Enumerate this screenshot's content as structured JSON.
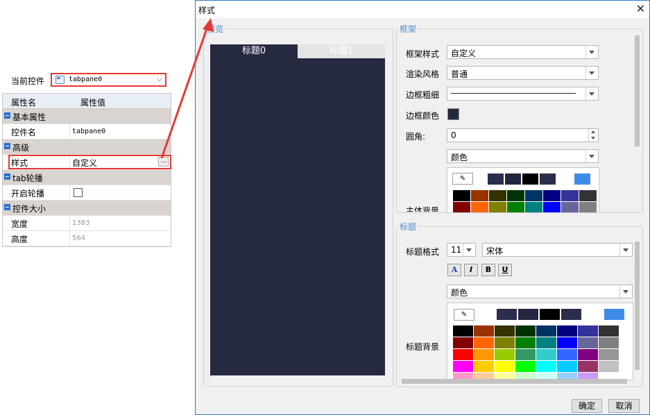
{
  "property_panel": {
    "current_control_label": "当前控件",
    "current_control_value": "tabpane0",
    "col_name": "属性名",
    "col_value": "属性值",
    "rows": [
      {
        "type": "category",
        "name": "基本属性"
      },
      {
        "type": "prop",
        "name": "控件名",
        "value": "tabpane0"
      },
      {
        "type": "category",
        "name": "高级"
      },
      {
        "type": "prop",
        "name": "样式",
        "value": "自定义",
        "ellipsis": "..."
      },
      {
        "type": "category",
        "name": "tab轮播"
      },
      {
        "type": "prop",
        "name": "开启轮播",
        "value": ""
      },
      {
        "type": "category",
        "name": "控件大小"
      },
      {
        "type": "prop",
        "name": "宽度",
        "value": "1383"
      },
      {
        "type": "prop",
        "name": "高度",
        "value": "564"
      }
    ]
  },
  "dialog": {
    "title": "样式",
    "close": "✕",
    "preview": {
      "legend": "预览",
      "tabs": [
        "标题0",
        "标题1"
      ]
    },
    "frame": {
      "legend": "框架",
      "frame_style_label": "框架样式",
      "frame_style_value": "自定义",
      "render_label": "渲染风格",
      "render_value": "普通",
      "border_width_label": "边框粗细",
      "border_color_label": "边框颜色",
      "radius_label": "圆角:",
      "radius_value": "0",
      "fill_value": "颜色",
      "body_bg_label": "主体背景"
    },
    "title_section": {
      "legend": "标题",
      "format_label": "标题格式",
      "size_value": "11",
      "font_value": "宋体",
      "bold_label": "B",
      "italic_label": "I",
      "underline_label": "U",
      "color_a_label": "A",
      "fill_value": "颜色",
      "bg_label": "标题背景"
    },
    "ok_label": "确定",
    "cancel_label": "取消"
  },
  "colors": {
    "accent": "#4a8bd0",
    "highlight": "#e53935",
    "preview_bg": "#262a40",
    "recent": [
      "#2b2e4a",
      "#242640",
      "#000000",
      "#2b2e4a",
      "#ffffff",
      "#3c8ce7"
    ],
    "palette_rows": [
      [
        "#000000",
        "#993300",
        "#333300",
        "#003300",
        "#003366",
        "#000080",
        "#333399",
        "#333333"
      ],
      [
        "#800000",
        "#ff6600",
        "#808000",
        "#008000",
        "#008080",
        "#0000ff",
        "#666699",
        "#808080"
      ],
      [
        "#ff0000",
        "#ff9900",
        "#99cc00",
        "#339966",
        "#33cccc",
        "#3366ff",
        "#800080",
        "#969696"
      ],
      [
        "#ff00ff",
        "#ffcc00",
        "#ffff00",
        "#00ff00",
        "#00ffff",
        "#00ccff",
        "#993366",
        "#c0c0c0"
      ],
      [
        "#ff99cc",
        "#ffcc99",
        "#ffff99",
        "#ccffcc",
        "#ccffff",
        "#99ccff",
        "#cc99ff",
        "#ffffff"
      ]
    ]
  }
}
